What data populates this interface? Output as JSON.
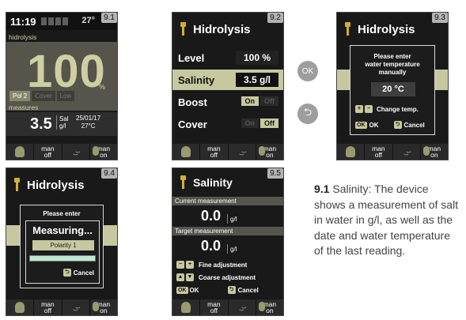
{
  "screen1": {
    "tag": "9.1",
    "time": "11:19",
    "temp_header": "27°",
    "section_label": "hidrolysis",
    "production_value": "100",
    "production_unit": "%",
    "polarity_tabs": [
      "Pol 2",
      "Cover",
      "Low"
    ],
    "measures_label": "measures",
    "salinity_value": "3.5",
    "salinity_unit_line1": "Sal",
    "salinity_unit_line2": "g/l",
    "date": "25/01/17",
    "water_temp": "27°C"
  },
  "screen2": {
    "tag": "9.2",
    "title": "Hidrolysis",
    "rows": {
      "level_label": "Level",
      "level_value": "100 %",
      "salinity_label": "Salinity",
      "salinity_value": "3.5 g/l",
      "boost_label": "Boost",
      "boost_on": "On",
      "boost_off": "Off",
      "cover_label": "Cover",
      "cover_on": "On",
      "cover_off": "Off"
    }
  },
  "screen3": {
    "tag": "9.3",
    "title": "Hidrolysis",
    "dialog_line1": "Please enter",
    "dialog_line2": "water temperature",
    "dialog_line3": "manually",
    "temp_value": "20 °C",
    "change_temp_label": "Change temp.",
    "ok_label": "OK",
    "cancel_label": "Cancel"
  },
  "screen4": {
    "tag": "9.4",
    "title": "Hidrolysis",
    "please_enter": "Please enter",
    "measuring_label": "Measuring...",
    "polarity_label": "Polarity 1",
    "progress": 1,
    "cancel_label": "Cancel"
  },
  "screen5": {
    "tag": "9.5",
    "title": "Salinity",
    "current_label": "Current measurement",
    "current_value": "0.0",
    "current_unit": "g/l",
    "target_label": "Target measurement",
    "target_value": "0.0",
    "target_unit": "g/l",
    "fine_label": "Fine adjustment",
    "coarse_label": "Coarse adjustment",
    "ok_label": "OK",
    "cancel_label": "Cancel"
  },
  "bottom_bar": {
    "man_off_line1": "man",
    "man_off_line2": "off",
    "man_on_line1": "man",
    "man_on_line2": "on"
  },
  "buttons": {
    "ok": "OK",
    "back": "⮌"
  },
  "description": {
    "bold": "9.1",
    "text": "Salinity: The device shows a measurement of salt in water in g/l, as well as the date and water temperature of the last reading."
  }
}
